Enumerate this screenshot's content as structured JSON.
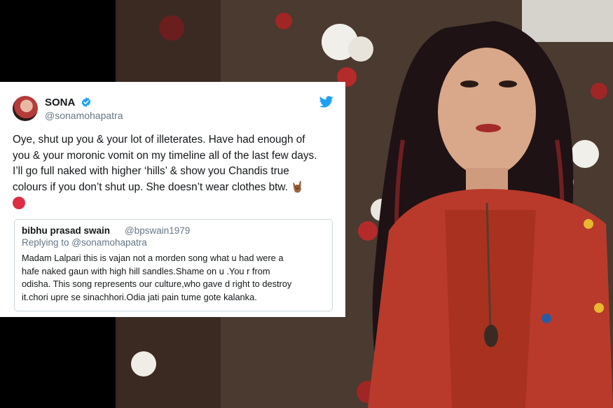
{
  "tweet": {
    "display_name": "SONA",
    "handle": "@sonamohapatra",
    "text_lines": [
      "Oye, shut up you & your lot of illeterates. Have had enough of",
      "you & your moronic vomit on my timeline all of the last few days.",
      "I’ll go full naked with higher ‘hills’ & show you Chandis true",
      "colours if you don’t shut up. She doesn’t wear clothes btw."
    ],
    "emoji": "🤘🏾",
    "icons": [
      "verified-badge-icon",
      "twitter-bird-icon",
      "red-circle-emoji"
    ],
    "colors": {
      "verified": "#1da1f2",
      "bird": "#1da1f2",
      "red_dot": "#dd2e44"
    }
  },
  "quoted": {
    "display_name": "bibhu prasad swain",
    "handle": "@bpswain1979",
    "reply_prefix": "Replying to ",
    "reply_to": "@sonamohapatra",
    "text_lines": [
      "Madam Lalpari this is vajan not a morden song what u had were a",
      "hafe naked gaun with high hill sandles.Shame on u .You r from",
      "odisha. This song represents our culture,who gave d right to destroy",
      "it.chori upre se sinachhori.Odia jati pain tume gote kalanka."
    ]
  }
}
